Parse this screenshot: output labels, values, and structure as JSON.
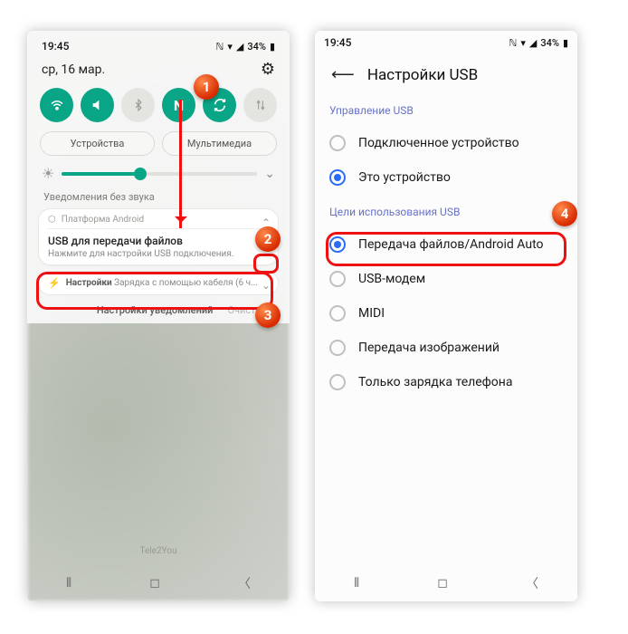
{
  "left": {
    "status": {
      "time": "19:45",
      "battery": "34%",
      "nfc": "ℕ",
      "wifi": "▾",
      "signal": "▮◢"
    },
    "date": "ср, 16 мар.",
    "quick": {
      "wifi_on": true,
      "sound_on": true,
      "bt_on": false,
      "nfc_on": true,
      "rotate_on": true,
      "swap_on": false
    },
    "chip_devices": "Устройства",
    "chip_media": "Мультимедиа",
    "silent_label": "Уведомления без звука",
    "android_platform": "Платформа Android",
    "usb_title": "USB для передачи файлов",
    "usb_sub": "Нажмите для настройки USB подключения.",
    "power_prefix": "Настройки",
    "power_text": "Зарядка с помощью кабеля (6 ч...",
    "footer_settings": "Настройки уведомлений",
    "footer_clear": "Очистить",
    "carrier": "Tele2You"
  },
  "right": {
    "status": {
      "time": "19:45",
      "battery": "34%"
    },
    "title": "Настройки USB",
    "group_control": "Управление USB",
    "opt_connected": "Подключенное устройство",
    "opt_this": "Это устройство",
    "group_purpose": "Цели использования USB",
    "opt_file": "Передача файлов/Android Auto",
    "opt_tether": "USB-модем",
    "opt_midi": "MIDI",
    "opt_ptp": "Передача изображений",
    "opt_charge": "Только зарядка телефона"
  },
  "markers": {
    "m1": "1",
    "m2": "2",
    "m3": "3",
    "m4": "4"
  }
}
